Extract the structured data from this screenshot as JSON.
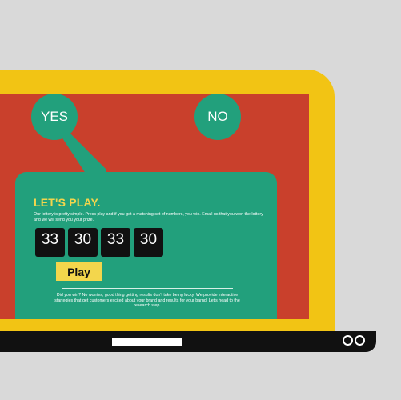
{
  "answers": {
    "yes_label": "YES",
    "no_label": "NO"
  },
  "game": {
    "title": "LET'S PLAY.",
    "intro": "Our lottery is pretty simple. Press play and if you get a matching set of numbers, you win. Email us that you won the lottery and we will send you your prize.",
    "numbers": [
      "33",
      "30",
      "33",
      "30"
    ],
    "play_label": "Play",
    "footer": "Did you win? No worries, good thing getting results don't take being lucky. We provide interactive startegies that get customers excited about your brand and results for your barnd. Let's head to the research step."
  },
  "colors": {
    "background": "#d9d9d9",
    "laptop_frame": "#f2c414",
    "screen": "#c9402c",
    "panel": "#22a07c",
    "accent": "#f3d64c",
    "digit_box": "#111111",
    "base": "#111111"
  }
}
